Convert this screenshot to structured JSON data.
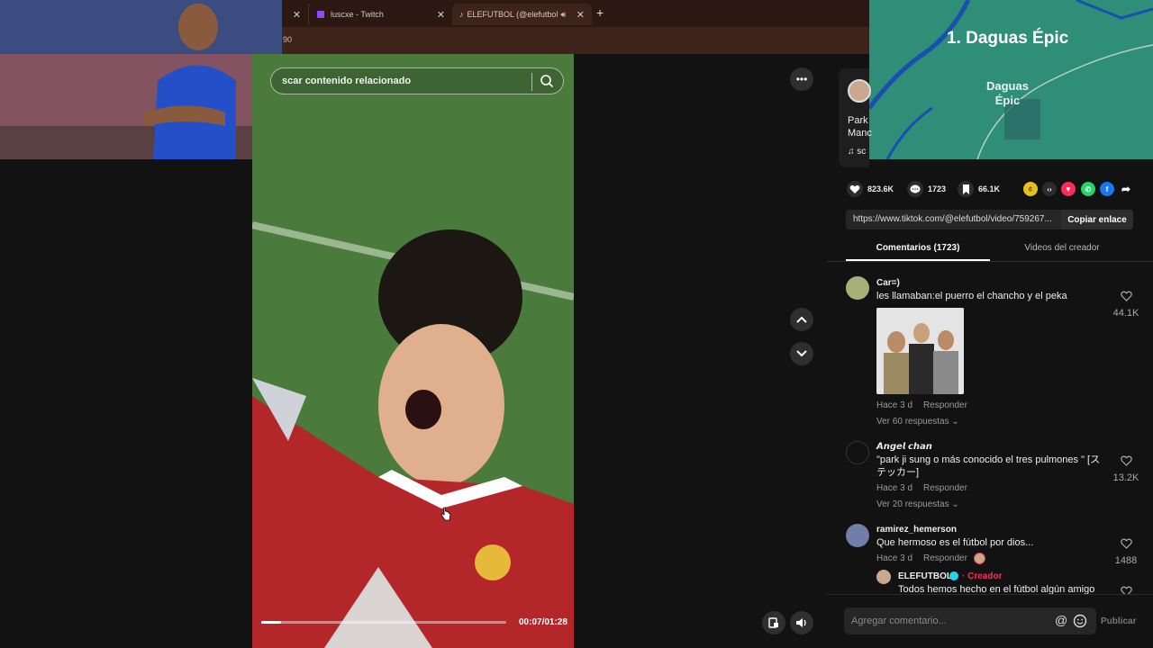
{
  "browser": {
    "tabs": [
      {
        "label": ""
      },
      {
        "label": "luscxe - Twitch"
      },
      {
        "label": "ELEFUTBOL (@elefutbol) o"
      }
    ],
    "new_tab": "+",
    "address_fragment": "90"
  },
  "video": {
    "search_placeholder": "scar contenido relacionado",
    "time": "00:07/01:28",
    "progress": 0.08
  },
  "minimap": {
    "title": "1. Daguas Épic",
    "place_line1": "Daguas",
    "place_line2": "Épic"
  },
  "post": {
    "desc_line1": "Park",
    "desc_line2": "Manc",
    "music": "sc",
    "likes": "823.6K",
    "comments": "1723",
    "saves": "66.1K",
    "link": "https://www.tiktok.com/@elefutbol/video/759267...",
    "copy_label": "Copiar enlace"
  },
  "tabs": {
    "comments_label": "Comentarios (1723)",
    "videos_label": "Videos del creador"
  },
  "comments": [
    {
      "name": "Car=)",
      "text": "les llamaban:el puerro el chancho y el peka",
      "time": "Hace 3 d",
      "reply": "Responder",
      "likes": "44.1K",
      "replies": "Ver 60 respuestas"
    },
    {
      "name": "𝘼𝙣𝙜𝙚𝙡 𝙘𝙝𝙖𝙣",
      "text_line1": "\"park ji sung o más conocido el tres pulmones \" [ス",
      "text_line2": "テッカー]",
      "time": "Hace 3 d",
      "reply": "Responder",
      "likes": "13.2K",
      "replies": "Ver 20 respuestas"
    },
    {
      "name": "ramirez_hemerson",
      "text": "Que hermoso es el fútbol por dios...",
      "time": "Hace 3 d",
      "reply": "Responder",
      "likes": "1488"
    }
  ],
  "creator_reply": {
    "name": "ELEFUTBOL",
    "badge": "Creador",
    "text": "Todos hemos hecho en el fútbol algún amigo"
  },
  "composer": {
    "placeholder": "Agregar comentario...",
    "publish": "Publicar"
  },
  "colors": {
    "accent_red": "#fe2c55",
    "verified_blue": "#20d5ec"
  }
}
